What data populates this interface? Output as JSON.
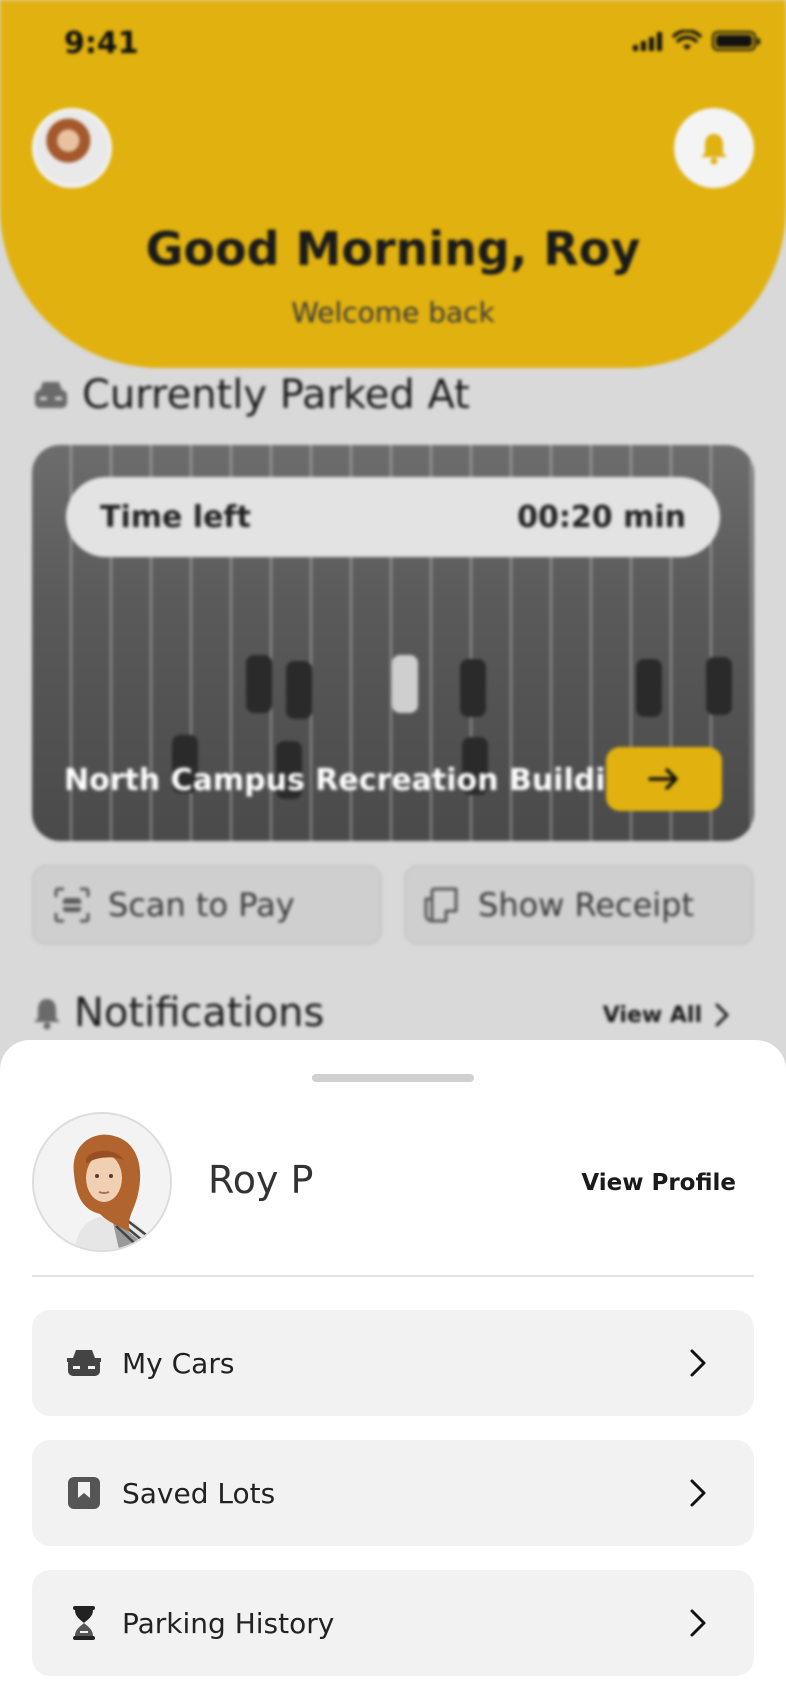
{
  "status_bar": {
    "time": "9:41"
  },
  "header": {
    "greeting": "Good Morning, Roy",
    "subtitle": "Welcome back"
  },
  "currently_parked": {
    "title": "Currently Parked At",
    "time_left_label": "Time left",
    "time_left_value": "00:20 min",
    "lot_name": "North Campus Recreation Building..."
  },
  "actions": {
    "scan_to_pay": "Scan to Pay",
    "show_receipt": "Show Receipt"
  },
  "notifications": {
    "title": "Notifications",
    "view_all": "View All"
  },
  "profile_sheet": {
    "name": "Roy P",
    "view_profile": "View Profile",
    "menu": [
      {
        "label": "My Cars",
        "icon": "car-icon"
      },
      {
        "label": "Saved Lots",
        "icon": "bookmark-icon"
      },
      {
        "label": "Parking History",
        "icon": "hourglass-icon"
      }
    ]
  },
  "colors": {
    "accent": "#e0b10f",
    "sheet_background": "#ffffff",
    "menu_item_background": "#f2f2f2",
    "dimmed_background": "#d9d9d9"
  }
}
